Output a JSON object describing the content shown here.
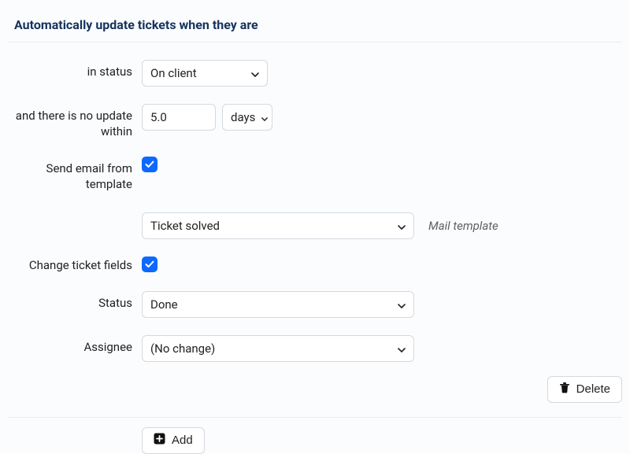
{
  "section_title": "Automatically update tickets when they are",
  "labels": {
    "in_status": "in status",
    "no_update": "and there is no update within",
    "send_email": "Send email from template",
    "change_fields": "Change ticket fields",
    "status": "Status",
    "assignee": "Assignee"
  },
  "values": {
    "status_filter": "On client",
    "duration_value": "5.0",
    "duration_unit": "days",
    "mail_template": "Ticket solved",
    "status_set": "Done",
    "assignee_set": "(No change)"
  },
  "hints": {
    "mail_template": "Mail template"
  },
  "buttons": {
    "delete": "Delete",
    "add": "Add"
  },
  "checks": {
    "send_email": true,
    "change_fields": true
  }
}
